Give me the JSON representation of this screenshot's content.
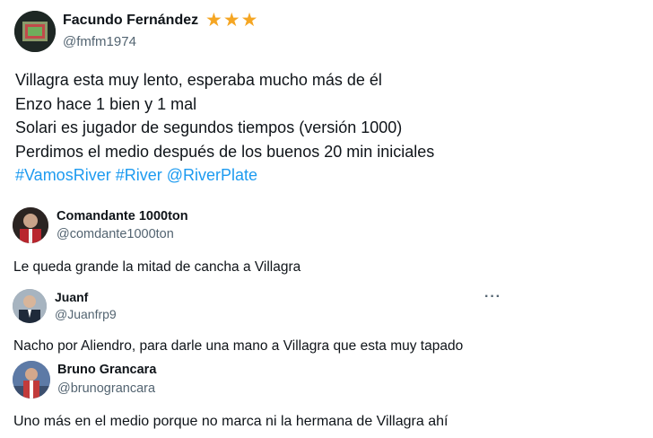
{
  "main_tweet": {
    "author_name": "Facundo Fernández",
    "author_handle": "@fmfm1974",
    "badges": [
      "star-icon",
      "star-icon",
      "star-icon"
    ],
    "lines": [
      "Villagra esta muy lento, esperaba mucho más de él",
      "Enzo hace 1 bien y 1 mal",
      "Solari es jugador de segundos tiempos (versión 1000)",
      "Perdimos el medio después de los buenos 20 min iniciales"
    ],
    "hashtags": [
      "#VamosRiver",
      "#River",
      "@RiverPlate"
    ]
  },
  "replies": [
    {
      "author_name": "Comandante 1000ton",
      "author_handle": "@comdante1000ton",
      "text": "Le queda grande  la mitad de cancha a Villagra"
    },
    {
      "author_name": "Juanf",
      "author_handle": "@Juanfrp9",
      "more_label": "···",
      "text": "Nacho por Aliendro, para darle una mano a Villagra que esta muy tapado"
    },
    {
      "author_name": "Bruno Grancara",
      "author_handle": "@brunograncara",
      "text": "Uno más en el medio porque no marca ni la hermana de Villagra ahí"
    }
  ],
  "colors": {
    "link": "#1d9bf0",
    "handle": "#536471",
    "star": "#f5a623"
  }
}
